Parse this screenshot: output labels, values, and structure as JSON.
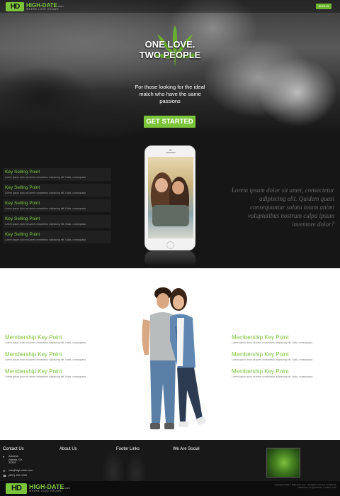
{
  "header": {
    "logo_mark": "HD",
    "logo_name": "HIGH-DATE",
    "logo_suffix": ".com",
    "logo_tagline": "WHERE LOVE GROWS",
    "signin_label": "SIGN IN"
  },
  "hero": {
    "headline_line1": "ONE LOVE.",
    "headline_line2": "TWO PEOPLE",
    "subline": "For those looking for the ideal match who have the same passions",
    "cta_label": "GET STARTED"
  },
  "selling_points": {
    "items": [
      {
        "title": "Key Selling Point",
        "text": "Lorem ipsum dolor sit amet consectetur adipiscing elit. Nulla, consequatur."
      },
      {
        "title": "Key Selling Point",
        "text": "Lorem ipsum dolor sit amet consectetur adipiscing elit. Nulla, consequatur."
      },
      {
        "title": "Key Selling Point",
        "text": "Lorem ipsum dolor sit amet consectetur adipiscing elit. Nulla, consequatur."
      },
      {
        "title": "Key Selling Point",
        "text": "Lorem ipsum dolor sit amet consectetur adipiscing elit. Nulla, consequatur."
      },
      {
        "title": "Key Selling Point",
        "text": "Lorem ipsum dolor sit amet consectetur adipiscing elit. Nulla, consequatur."
      }
    ],
    "quote": "Lorem ipsum dolor sit amet, consectetur adipiscing elit. Quidem quasi consequuntur soluta totam animi voluptatibus nostrum culpa ipsum inventore dolor?"
  },
  "membership": {
    "left": [
      {
        "title": "Membership Key Point",
        "text": "Lorem ipsum dolor sit amet consectetur adipiscing elit. Nulla, consequatur."
      },
      {
        "title": "Membership Key Point",
        "text": "Lorem ipsum dolor sit amet consectetur adipiscing elit. Nulla, consequatur."
      },
      {
        "title": "Membership Key Point",
        "text": "Lorem ipsum dolor sit amet consectetur adipiscing elit. Nulla, consequatur."
      }
    ],
    "right": [
      {
        "title": "Membership Key Point",
        "text": "Lorem ipsum dolor sit amet consectetur adipiscing elit. Nulla, consequatur."
      },
      {
        "title": "Membership Key Point",
        "text": "Lorem ipsum dolor sit amet consectetur adipiscing elit. Nulla, consequatur."
      },
      {
        "title": "Membership Key Point",
        "text": "Lorem ipsum dolor sit amet consectetur adipiscing elit. Nulla, consequatur."
      }
    ]
  },
  "footer": {
    "contact_heading": "Contact Us",
    "about_heading": "About Us",
    "links_heading": "Footer Links",
    "social_heading": "We Are Social",
    "address_line1": "Address",
    "address_line2": "Atlanta, GA",
    "address_line3": "30303",
    "email": "info@high-date.com",
    "phone": "(800) 420-0420",
    "copyright": "Copyright 2019 © High-Date.com - All rights reserved. Conditions, Disclaimer & Legal Notice, Cookies, T&C"
  },
  "colors": {
    "accent": "#7cc53b",
    "dark": "#161616",
    "footer": "#181818"
  },
  "icons": [
    "cannabis-leaf-icon",
    "location-icon",
    "email-icon",
    "phone-icon"
  ]
}
